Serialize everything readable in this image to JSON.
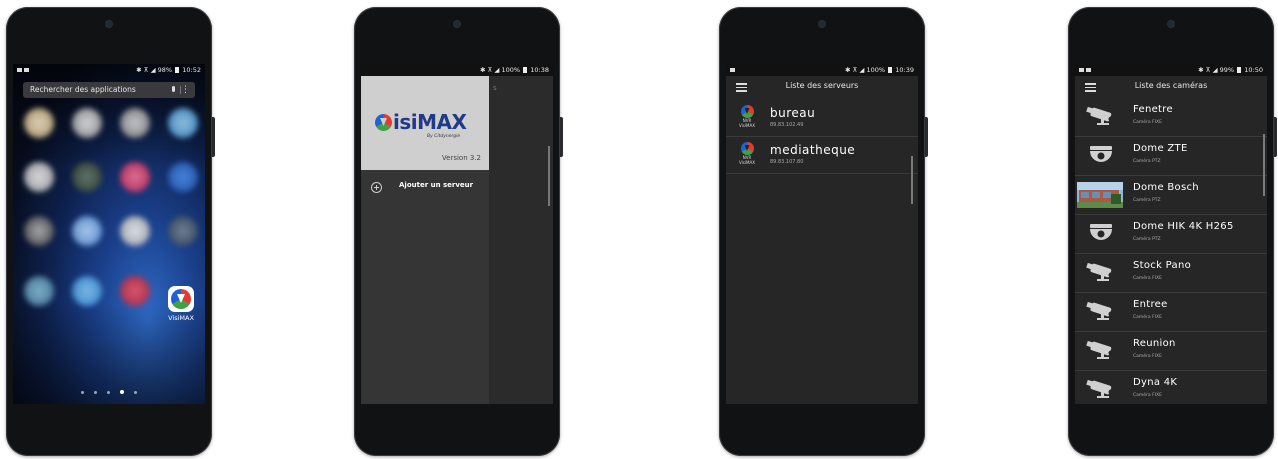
{
  "phone1": {
    "status": {
      "indicators": "✱ ⊼ ◢",
      "battery": "98%",
      "time": "10:52"
    },
    "search_placeholder": "Rechercher des applications",
    "more_glyph": "⋮",
    "app_label": "VisiMAX"
  },
  "phone2": {
    "status": {
      "indicators": "✱ ⊼ ◢",
      "battery": "100%",
      "time": "10:38"
    },
    "logo_rest": "isiMAX",
    "logo_sub": "By Citdynergie",
    "version": "Version 3.2",
    "menu_item": "Ajouter un serveur",
    "ghost_title": "s"
  },
  "phone3": {
    "status": {
      "indicators": "✱ ⊼ ◢",
      "battery": "100%",
      "time": "10:39"
    },
    "title": "Liste des serveurs",
    "logo_text": [
      "NVR",
      "VisiMAX"
    ],
    "servers": [
      {
        "name": "bureau",
        "ip": "89.83.102.49"
      },
      {
        "name": "mediatheque",
        "ip": "89.83.107.80"
      }
    ]
  },
  "phone4": {
    "status": {
      "indicators": "✱ ⊼ ◢",
      "battery": "99%",
      "time": "10:50"
    },
    "title": "Liste des caméras",
    "cameras": [
      {
        "name": "Fenetre",
        "type": "Caméra FIXE",
        "icon": "bullet-camera-icon"
      },
      {
        "name": "Dome ZTE",
        "type": "Caméra PTZ",
        "icon": "dome-camera-icon"
      },
      {
        "name": "Dome Bosch",
        "type": "Caméra PTZ",
        "icon": "camera-snapshot"
      },
      {
        "name": "Dome HIK 4K H265",
        "type": "Caméra PTZ",
        "icon": "dome-camera-icon"
      },
      {
        "name": "Stock Pano",
        "type": "Caméra FIXE",
        "icon": "bullet-camera-icon"
      },
      {
        "name": "Entree",
        "type": "Caméra FIXE",
        "icon": "bullet-camera-icon"
      },
      {
        "name": "Reunion",
        "type": "Caméra FIXE",
        "icon": "bullet-camera-icon"
      },
      {
        "name": "Dyna 4K",
        "type": "Caméra FIXE",
        "icon": "bullet-camera-icon"
      }
    ]
  },
  "colors": {
    "app_bg": "#262626",
    "drawer_header": "#cfcfcf",
    "logo_blue": "#1f3a8a",
    "logo_red": "#e53935",
    "logo_green": "#43a047"
  }
}
